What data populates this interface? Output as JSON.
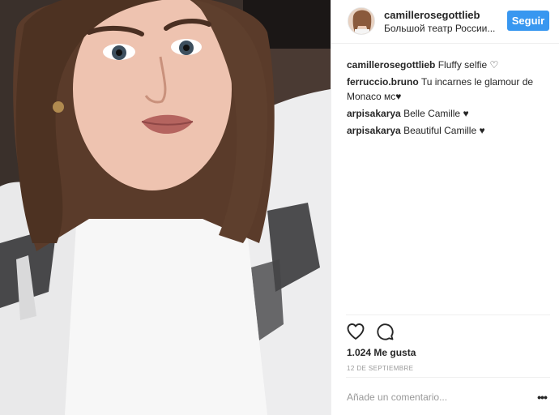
{
  "post": {
    "photo_description": "selfie photo",
    "header": {
      "username": "camillerosegottlieb",
      "location": "Большой театр России...",
      "follow_label": "Seguir"
    },
    "comments": [
      {
        "user": "camillerosegottlieb",
        "text": "Fluffy selfie ♡"
      },
      {
        "user": "ferruccio.bruno",
        "text": "Tu incarnes le glamour de Monaco мс♥"
      },
      {
        "user": "arpisakarya",
        "text": "Belle Camille ♥"
      },
      {
        "user": "arpisakarya",
        "text": "Beautiful Camille ♥"
      }
    ],
    "actions": {
      "like_icon": "heart-icon",
      "comment_icon": "comment-icon"
    },
    "likes_text": "1.024 Me gusta",
    "date_text": "12 de septiembre",
    "add_comment_placeholder": "Añade un comentario...",
    "more_label": "•••",
    "colors": {
      "follow_button": "#3897f0",
      "text": "#262626",
      "muted": "#999999",
      "border": "#efefef"
    }
  }
}
